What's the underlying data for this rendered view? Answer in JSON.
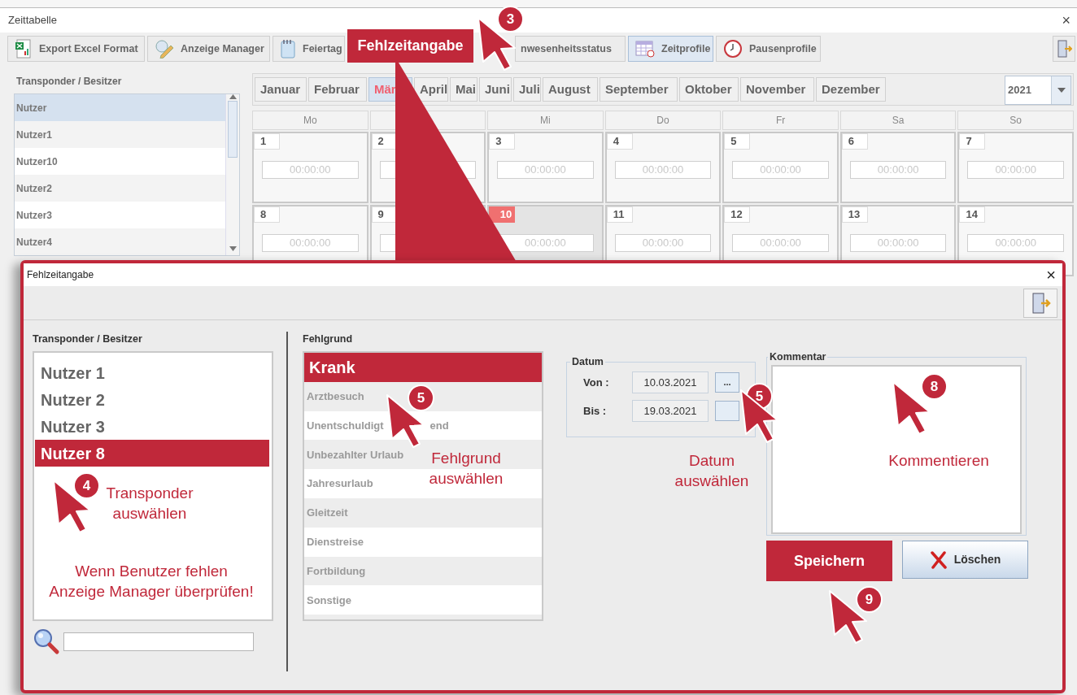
{
  "window": {
    "title": "Zeittabelle",
    "close": "×"
  },
  "toolbar": [
    {
      "label": "Export Excel Format",
      "kind": "spreadsheet",
      "selected": false
    },
    {
      "label": "Anzeige Manager",
      "kind": "pencil",
      "selected": false
    },
    {
      "label": "Feiertag",
      "kind": "notepad",
      "selected": false
    },
    {
      "label": "nwesenheitsstatus",
      "selected": false
    },
    {
      "label": "Zeitprofile",
      "kind": "calendar",
      "selected": true
    },
    {
      "label": "Pausenprofile",
      "kind": "clock",
      "selected": false
    }
  ],
  "transponder_panel": {
    "title": "Transponder / Besitzer",
    "items": [
      {
        "label": "Nutzer",
        "selected": true
      },
      {
        "label": "Nutzer1",
        "selected": false
      },
      {
        "label": "Nutzer10",
        "selected": false
      },
      {
        "label": "Nutzer2",
        "selected": false
      },
      {
        "label": "Nutzer3",
        "selected": false
      },
      {
        "label": "Nutzer4",
        "selected": false
      }
    ]
  },
  "months": [
    {
      "label": "Januar",
      "selected": false
    },
    {
      "label": "Februar",
      "selected": false
    },
    {
      "label": "Mär",
      "selected": true
    },
    {
      "label": "April",
      "selected": false
    },
    {
      "label": "Mai",
      "selected": false
    },
    {
      "label": "Juni",
      "selected": false
    },
    {
      "label": "Juli",
      "selected": false
    },
    {
      "label": "August",
      "selected": false
    },
    {
      "label": "September",
      "selected": false
    },
    {
      "label": "Oktober",
      "selected": false
    },
    {
      "label": "November",
      "selected": false
    },
    {
      "label": "Dezember",
      "selected": false
    }
  ],
  "year": "2021",
  "weekdays": [
    {
      "label": "Mo"
    },
    {
      "label": "Mi"
    },
    {
      "label": "Do"
    },
    {
      "label": "Fr"
    },
    {
      "label": "Sa"
    },
    {
      "label": "So"
    }
  ],
  "weeks": [
    {
      "days": [
        {
          "day": "1",
          "time": "00:00:00",
          "selected": false
        },
        {
          "day": "2",
          "selected": false
        },
        {
          "day": "3",
          "time": "00:00:00",
          "selected": false
        },
        {
          "day": "4",
          "time": "00:00:00",
          "selected": false
        },
        {
          "day": "5",
          "time": "00:00:00",
          "selected": false
        },
        {
          "day": "6",
          "time": "00:00:00",
          "selected": false
        },
        {
          "day": "7",
          "time": "00:00:00",
          "selected": false
        }
      ]
    },
    {
      "days": [
        {
          "day": "8",
          "time": "00:00:00",
          "selected": false
        },
        {
          "day": "9",
          "selected": false
        },
        {
          "day": "10",
          "time": "00:00:00",
          "selected": true
        },
        {
          "day": "11",
          "time": "00:00:00",
          "selected": false
        },
        {
          "day": "12",
          "time": "00:00:00",
          "selected": false
        },
        {
          "day": "13",
          "time": "00:00:00",
          "selected": false
        },
        {
          "day": "14",
          "time": "00:00:00",
          "selected": false
        }
      ]
    }
  ],
  "dialog": {
    "title": "Fehlzeitangabe",
    "close": "×",
    "transponder": {
      "title": "Transponder / Besitzer",
      "items": [
        {
          "label": "Nutzer 1",
          "selected": false
        },
        {
          "label": "Nutzer 2",
          "selected": false
        },
        {
          "label": "Nutzer 3",
          "selected": false
        },
        {
          "label": "Nutzer 8",
          "selected": true
        }
      ]
    },
    "reason": {
      "title": "Fehlgrund",
      "items": [
        {
          "label": "Krank",
          "selected": true
        },
        {
          "label": "Arztbesuch",
          "selected": false
        },
        {
          "label": "Unentschuldigt",
          "tail": "end",
          "selected": false
        },
        {
          "label": "Unbezahlter Urlaub",
          "selected": false
        },
        {
          "label": "Jahresurlaub",
          "selected": false
        },
        {
          "label": "Gleitzeit",
          "selected": false
        },
        {
          "label": "Dienstreise",
          "selected": false
        },
        {
          "label": "Fortbildung",
          "selected": false
        },
        {
          "label": "Sonstige",
          "selected": false
        }
      ]
    },
    "date": {
      "title": "Datum",
      "from_label": "Von :",
      "from": "10.03.2021",
      "from_button": "...",
      "to_label": "Bis :",
      "to": "19.03.2021"
    },
    "comment": {
      "title": "Kommentar"
    },
    "buttons": [
      {
        "label": "Speichern",
        "kind": "primary"
      },
      {
        "label": "Löschen",
        "kind": "delete"
      }
    ]
  },
  "annotations": [
    {
      "kind": "label",
      "text": "Fehlzeitangabe"
    },
    {
      "kind": "badge",
      "text": "3"
    },
    {
      "kind": "badge",
      "text": "4"
    },
    {
      "kind": "caption",
      "text": "Transponder\nauswählen"
    },
    {
      "kind": "caption",
      "text": "Wenn Benutzer fehlen\nAnzeige Manager überprüfen!"
    },
    {
      "kind": "badge",
      "text": "5"
    },
    {
      "kind": "caption",
      "text": "Fehlgrund\nauswählen"
    },
    {
      "kind": "badge",
      "text": "5"
    },
    {
      "kind": "caption",
      "text": "Datum\nauswählen"
    },
    {
      "kind": "badge",
      "text": "8"
    },
    {
      "kind": "caption",
      "text": "Kommentieren"
    },
    {
      "kind": "badge",
      "text": "9"
    }
  ]
}
